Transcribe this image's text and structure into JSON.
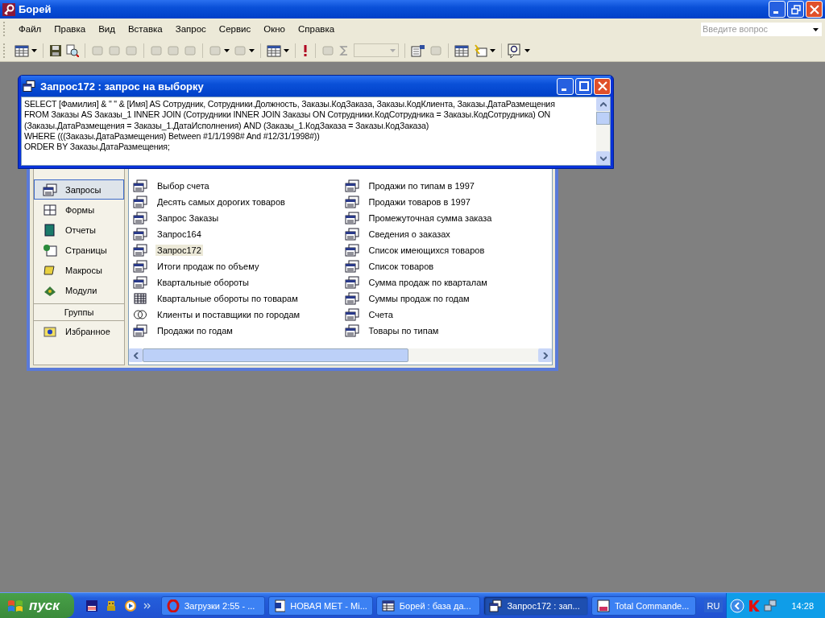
{
  "window": {
    "title": "Борей"
  },
  "menu": [
    "Файл",
    "Правка",
    "Вид",
    "Вставка",
    "Запрос",
    "Сервис",
    "Окно",
    "Справка"
  ],
  "help_search": {
    "placeholder": "Введите вопрос"
  },
  "query_window": {
    "title": "Запрос172 : запрос на выборку",
    "sql_lines": [
      "SELECT [Фамилия] & \" \" & [Имя] AS Сотрудник, Сотрудники.Должность, Заказы.КодЗаказа, Заказы.КодКлиента, Заказы.ДатаРазмещения",
      "FROM Заказы AS Заказы_1 INNER JOIN (Сотрудники INNER JOIN Заказы ON Сотрудники.КодСотрудника = Заказы.КодСотрудника) ON",
      "(Заказы.ДатаРазмещения = Заказы_1.ДатаИсполнения) AND (Заказы_1.КодЗаказа = Заказы.КодЗаказа)",
      "WHERE (((Заказы.ДатаРазмещения) Between #1/1/1998# And #12/31/1998#))",
      "ORDER BY Заказы.ДатаРазмещения;"
    ]
  },
  "db_window": {
    "objects": [
      {
        "label": "Запросы",
        "kind": "queries",
        "selected": true
      },
      {
        "label": "Формы",
        "kind": "forms",
        "selected": false
      },
      {
        "label": "Отчеты",
        "kind": "reports",
        "selected": false
      },
      {
        "label": "Страницы",
        "kind": "pages",
        "selected": false
      },
      {
        "label": "Макросы",
        "kind": "macros",
        "selected": false
      },
      {
        "label": "Модули",
        "kind": "modules",
        "selected": false
      }
    ],
    "groups_header": "Группы",
    "groups": [
      {
        "label": "Избранное",
        "kind": "favorites",
        "selected": false
      }
    ],
    "items": [
      {
        "label": "Выбор счета",
        "kind": "select",
        "selected": false
      },
      {
        "label": "Десять самых дорогих товаров",
        "kind": "select",
        "selected": false
      },
      {
        "label": "Запрос Заказы",
        "kind": "select",
        "selected": false
      },
      {
        "label": "Запрос164",
        "kind": "select",
        "selected": false
      },
      {
        "label": "Запрос172",
        "kind": "select",
        "selected": true
      },
      {
        "label": "Итоги продаж по объему",
        "kind": "select",
        "selected": false
      },
      {
        "label": "Квартальные обороты",
        "kind": "select",
        "selected": false
      },
      {
        "label": "Квартальные обороты по товарам",
        "kind": "crosstab",
        "selected": false
      },
      {
        "label": "Клиенты и поставщики по городам",
        "kind": "union",
        "selected": false
      },
      {
        "label": "Продажи по годам",
        "kind": "select",
        "selected": false
      },
      {
        "label": "Продажи по типам в 1997",
        "kind": "select",
        "selected": false
      },
      {
        "label": "Продажи товаров в 1997",
        "kind": "select",
        "selected": false
      },
      {
        "label": "Промежуточная сумма заказа",
        "kind": "select",
        "selected": false
      },
      {
        "label": "Сведения о заказах",
        "kind": "select",
        "selected": false
      },
      {
        "label": "Список имеющихся товаров",
        "kind": "select",
        "selected": false
      },
      {
        "label": "Список товаров",
        "kind": "select",
        "selected": false
      },
      {
        "label": "Сумма продаж по кварталам",
        "kind": "select",
        "selected": false
      },
      {
        "label": "Суммы продаж по годам",
        "kind": "select",
        "selected": false
      },
      {
        "label": "Счета",
        "kind": "select",
        "selected": false
      },
      {
        "label": "Товары по типам",
        "kind": "select",
        "selected": false
      }
    ]
  },
  "taskbar": {
    "start": "пуск",
    "tasks": [
      {
        "label": "Загрузки 2:55 - ...",
        "kind": "browser",
        "selected": false
      },
      {
        "label": "НОВАЯ МЕТ - Mi...",
        "kind": "document",
        "selected": false
      },
      {
        "label": "Борей : база да...",
        "kind": "database",
        "selected": false
      },
      {
        "label": "Запрос172 : зап...",
        "kind": "query",
        "selected": true
      },
      {
        "label": "Total Commande...",
        "kind": "disk",
        "selected": false
      }
    ],
    "language": "RU",
    "clock": "14:28"
  }
}
